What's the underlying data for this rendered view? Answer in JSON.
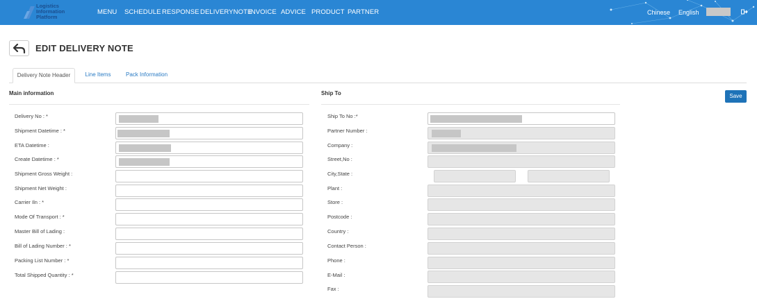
{
  "app": {
    "logo_lines": [
      "Logistics",
      "Information",
      "Platform"
    ]
  },
  "nav": {
    "items": [
      "MENU",
      "SCHEDULE",
      "RESPONSE",
      "DELIVERYNOTE",
      "INVOICE",
      "ADVICE",
      "PRODUCT",
      "PARTNER"
    ],
    "lang_chinese": "Chinese",
    "lang_english": "English"
  },
  "page": {
    "title": "EDIT DELIVERY NOTE",
    "save_label": "Save"
  },
  "tabs": [
    "Delivery Note Header",
    "Line Items",
    "Pack Information"
  ],
  "main_info": {
    "title": "Main information",
    "fields": [
      "Delivery No : *",
      "Shipment Datetime : *",
      "ETA Datetime :",
      "Create Datetime : *",
      "Shipment Gross Weight :",
      "Shipment Net Weight :",
      "Carrier Iln : *",
      "Mode Of Transport : *",
      "Master Bill of Lading :",
      "Bill of Lading Number : *",
      "Packing List Number : *",
      "Total Shipped Quantity : *"
    ]
  },
  "ship_to": {
    "title": "Ship To",
    "fields": [
      "Ship To No :*",
      "Partner Number :",
      "Company :",
      "Street,No :",
      "City,State :",
      "Plant :",
      "Store :",
      "Postcode :",
      "Country :",
      "Contact Person :",
      "Phone :",
      "E-Mail :",
      "Fax :"
    ]
  },
  "colors": {
    "topbar": "#2a86d4",
    "primary_button": "#1e73b8",
    "tab_link": "#2a7bc4"
  }
}
